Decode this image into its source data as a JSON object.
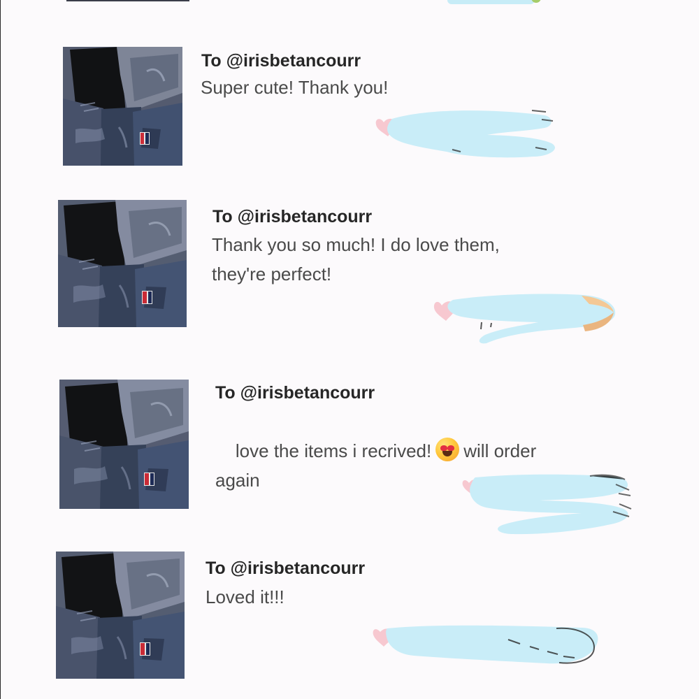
{
  "reviews": [
    {
      "recipient": "To @irisbetancourr",
      "message": "Super cute! Thank you!"
    },
    {
      "recipient": "To @irisbetancourr",
      "message": "Thank you so much! I do love them,\nthey're perfect!"
    },
    {
      "recipient": "To @irisbetancourr",
      "message_part1": "love the items i recrived!",
      "message_part2": "will order\nagain",
      "emoji": "heart-eyes-emoji"
    },
    {
      "recipient": "To @irisbetancourr",
      "message": "Loved it!!!"
    }
  ],
  "colors": {
    "background": "#fcfafc",
    "title": "#262626",
    "message": "#4a4a4a",
    "redaction_blue": "#c9edf8",
    "heart_pink": "#f8c7cf"
  }
}
